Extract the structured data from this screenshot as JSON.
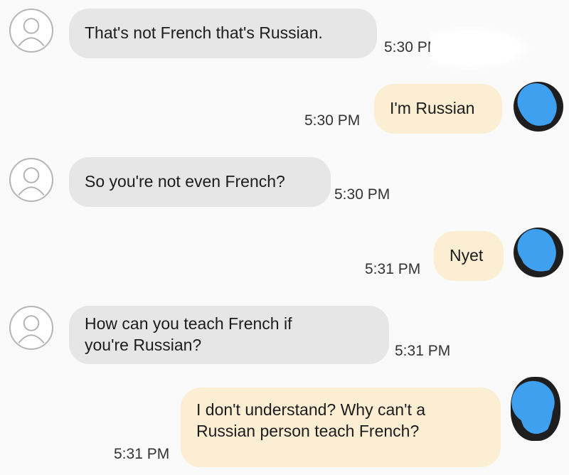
{
  "messages": [
    {
      "direction": "incoming",
      "text": "That's not French that's Russian.",
      "time": "5:30 PM"
    },
    {
      "direction": "outgoing",
      "text": "I'm Russian",
      "time": "5:30 PM"
    },
    {
      "direction": "incoming",
      "text": "So you're not even French?",
      "time": "5:30 PM"
    },
    {
      "direction": "outgoing",
      "text": "Nyet",
      "time": "5:31 PM"
    },
    {
      "direction": "incoming",
      "text": "How can you teach French if you're Russian?",
      "time": "5:31 PM"
    },
    {
      "direction": "outgoing",
      "text": "I don't understand? Why can't a Russian person teach French?",
      "time": "5:31 PM"
    }
  ],
  "colors": {
    "incoming_bubble": "#e6e6e6",
    "outgoing_bubble": "#fbeed3",
    "avatar_fill": "#3fa0f0"
  },
  "icons": {
    "contact_avatar": "person-outline-icon",
    "own_avatar": "profile-photo-redacted"
  }
}
